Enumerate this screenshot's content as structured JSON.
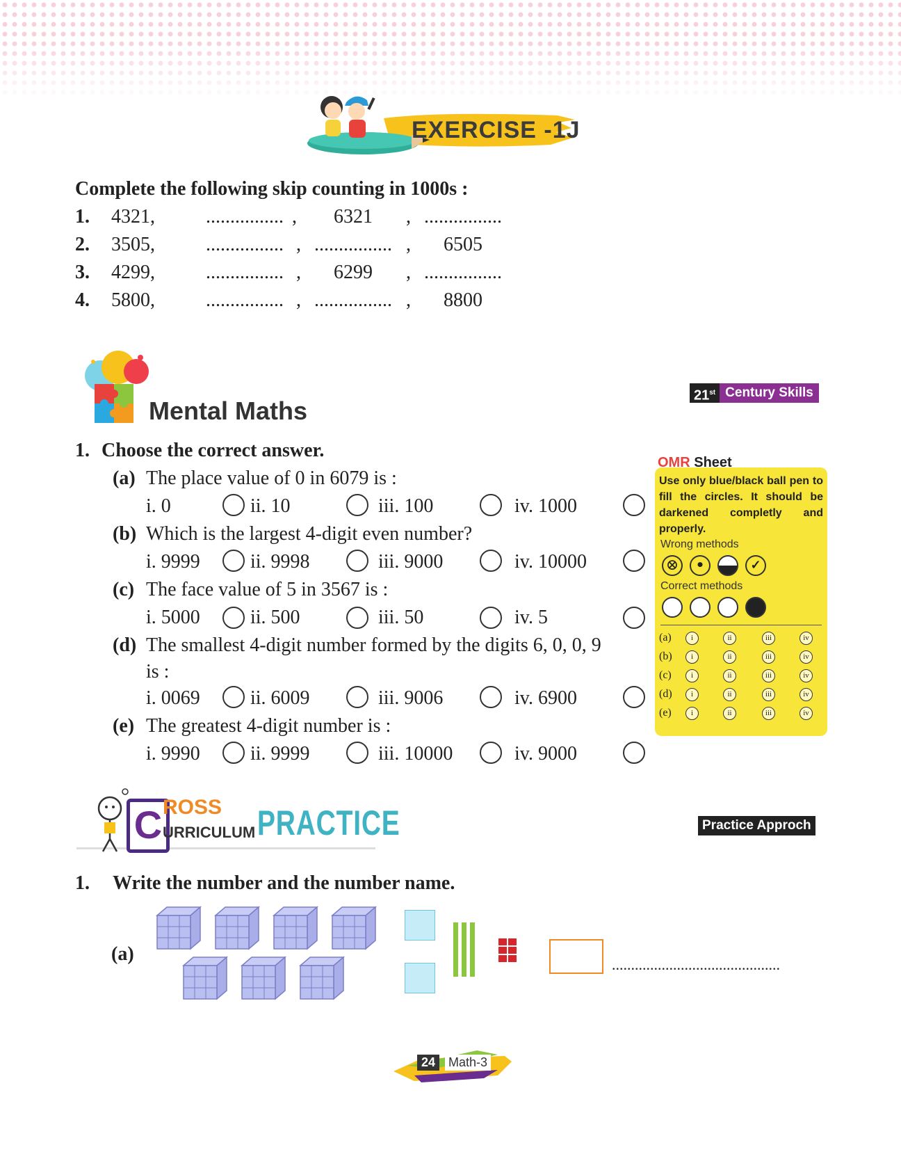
{
  "exercise": {
    "title": "EXERCISE -1J"
  },
  "skip_counting": {
    "heading": "Complete the following skip counting in 1000s :",
    "rows": [
      {
        "num": "1.",
        "first": "4321,",
        "c1": "................",
        "sep1": ",",
        "c2": "6321",
        "sep2": ",",
        "c3": "................"
      },
      {
        "num": "2.",
        "first": "3505,",
        "c1": "................",
        "sep1": ",",
        "c2": "................",
        "sep2": ",",
        "c3": "6505"
      },
      {
        "num": "3.",
        "first": "4299,",
        "c1": "................",
        "sep1": ",",
        "c2": "6299",
        "sep2": ",",
        "c3": "................"
      },
      {
        "num": "4.",
        "first": "5800,",
        "c1": "................",
        "sep1": ",",
        "c2": "................",
        "sep2": ",",
        "c3": "8800"
      }
    ]
  },
  "mental_maths": {
    "title": "Mental Maths",
    "badge_num": "21",
    "badge_sup": "st",
    "badge_text": "Century Skills",
    "question": {
      "num": "1.",
      "text": "Choose the correct answer."
    },
    "items": [
      {
        "label": "(a)",
        "text": "The place value of 0 in 6079 is :",
        "text2": "",
        "options": [
          "i.  0",
          "ii.  10",
          "iii.  100",
          "iv.  1000"
        ]
      },
      {
        "label": "(b)",
        "text": "Which is the largest 4-digit even number?",
        "text2": "",
        "options": [
          "i.  9999",
          "ii.  9998",
          "iii.  9000",
          "iv.  10000"
        ]
      },
      {
        "label": "(c)",
        "text": "The face value of 5 in 3567 is :",
        "text2": "",
        "options": [
          "i.  5000",
          "ii.  500",
          "iii.  50",
          "iv.  5"
        ]
      },
      {
        "label": "(d)",
        "text": "The smallest 4-digit number formed by the digits 6, 0, 0, 9",
        "text2": "is :",
        "options": [
          "i.  0069",
          "ii.  6009",
          "iii.  9006",
          "iv.  6900"
        ]
      },
      {
        "label": "(e)",
        "text": "The greatest 4-digit number is :",
        "text2": "",
        "options": [
          "i.  9990",
          "ii.  9999",
          "iii.  10000",
          "iv.  9000"
        ]
      }
    ]
  },
  "omr": {
    "title_red": "OMR",
    "title_black": "Sheet",
    "instructions": "Use only blue/black ball pen to fill the circles. It should be darkened completly and properly.",
    "wrong_label": "Wrong  methods",
    "correct_label": "Correct methods",
    "rows": [
      "(a)",
      "(b)",
      "(c)",
      "(d)",
      "(e)"
    ],
    "choices": [
      "i",
      "ii",
      "iii",
      "iv"
    ],
    "wrong_marks": [
      "⊗",
      "•",
      "◒",
      "✓"
    ]
  },
  "cross_curriculum": {
    "logo_c": "C",
    "logo_ross": "ROSS",
    "logo_urriculum": "URRICULUM",
    "logo_practice": "PRACTICE",
    "badge": "Practice Approch",
    "question": {
      "num": "1.",
      "text": "Write the number and the number name."
    },
    "part_label": "(a)",
    "answer_line": "............................................"
  },
  "footer": {
    "page": "24",
    "book": "Math-3"
  },
  "colors": {
    "omr_yellow": "#f7e53a",
    "cube_blue": "#b9bff0",
    "rod_green": "#8cc63f",
    "unit_red": "#d6262c",
    "box_orange": "#f08a24",
    "flat_cyan": "#c6ecf8",
    "purple": "#6a2c8e"
  }
}
